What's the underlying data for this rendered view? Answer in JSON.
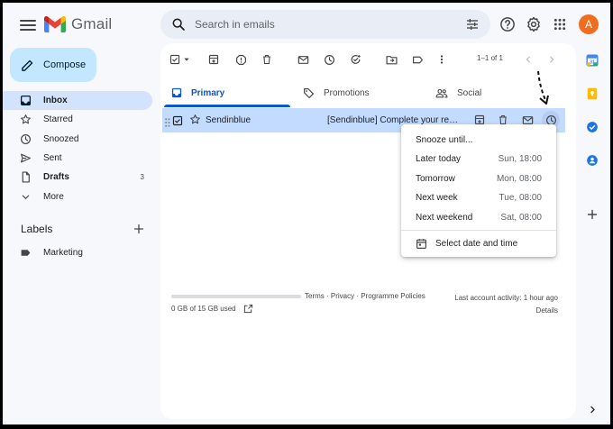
{
  "app": {
    "name": "Gmail",
    "avatar_letter": "A",
    "accent": "#0b57d0"
  },
  "search": {
    "placeholder": "Search in emails"
  },
  "compose": {
    "label": "Compose"
  },
  "nav": {
    "items": [
      {
        "label": "Inbox",
        "icon": "inbox-icon",
        "count": ""
      },
      {
        "label": "Starred",
        "icon": "star-icon",
        "count": ""
      },
      {
        "label": "Snoozed",
        "icon": "clock-icon",
        "count": ""
      },
      {
        "label": "Sent",
        "icon": "send-icon",
        "count": ""
      },
      {
        "label": "Drafts",
        "icon": "draft-icon",
        "count": "3"
      },
      {
        "label": "More",
        "icon": "chevron-down-icon",
        "count": ""
      }
    ]
  },
  "labels": {
    "title": "Labels",
    "items": [
      {
        "label": "Marketing",
        "icon": "label-tag-icon"
      }
    ]
  },
  "toolbar": {
    "pager": "1–1 of 1"
  },
  "tabs": [
    {
      "label": "Primary",
      "icon": "inbox-icon",
      "active": true
    },
    {
      "label": "Promotions",
      "icon": "tag-icon",
      "active": false
    },
    {
      "label": "Social",
      "icon": "people-icon",
      "active": false
    }
  ],
  "email": {
    "sender": "Sendinblue",
    "subject": "[Sendinblue] Complete your registration"
  },
  "footer": {
    "storage": "0 GB of 15 GB used",
    "storage_fraction": 0,
    "links": "Terms · Privacy · Programme Policies",
    "activity": "Last account activity: 1 hour ago",
    "details": "Details"
  },
  "snooze_menu": {
    "title": "Snooze until...",
    "options": [
      {
        "label": "Later today",
        "time": "Sun, 18:00"
      },
      {
        "label": "Tomorrow",
        "time": "Mon, 08:00"
      },
      {
        "label": "Next week",
        "time": "Tue, 08:00"
      },
      {
        "label": "Next weekend",
        "time": "Sat, 08:00"
      }
    ],
    "custom": "Select date and time"
  }
}
